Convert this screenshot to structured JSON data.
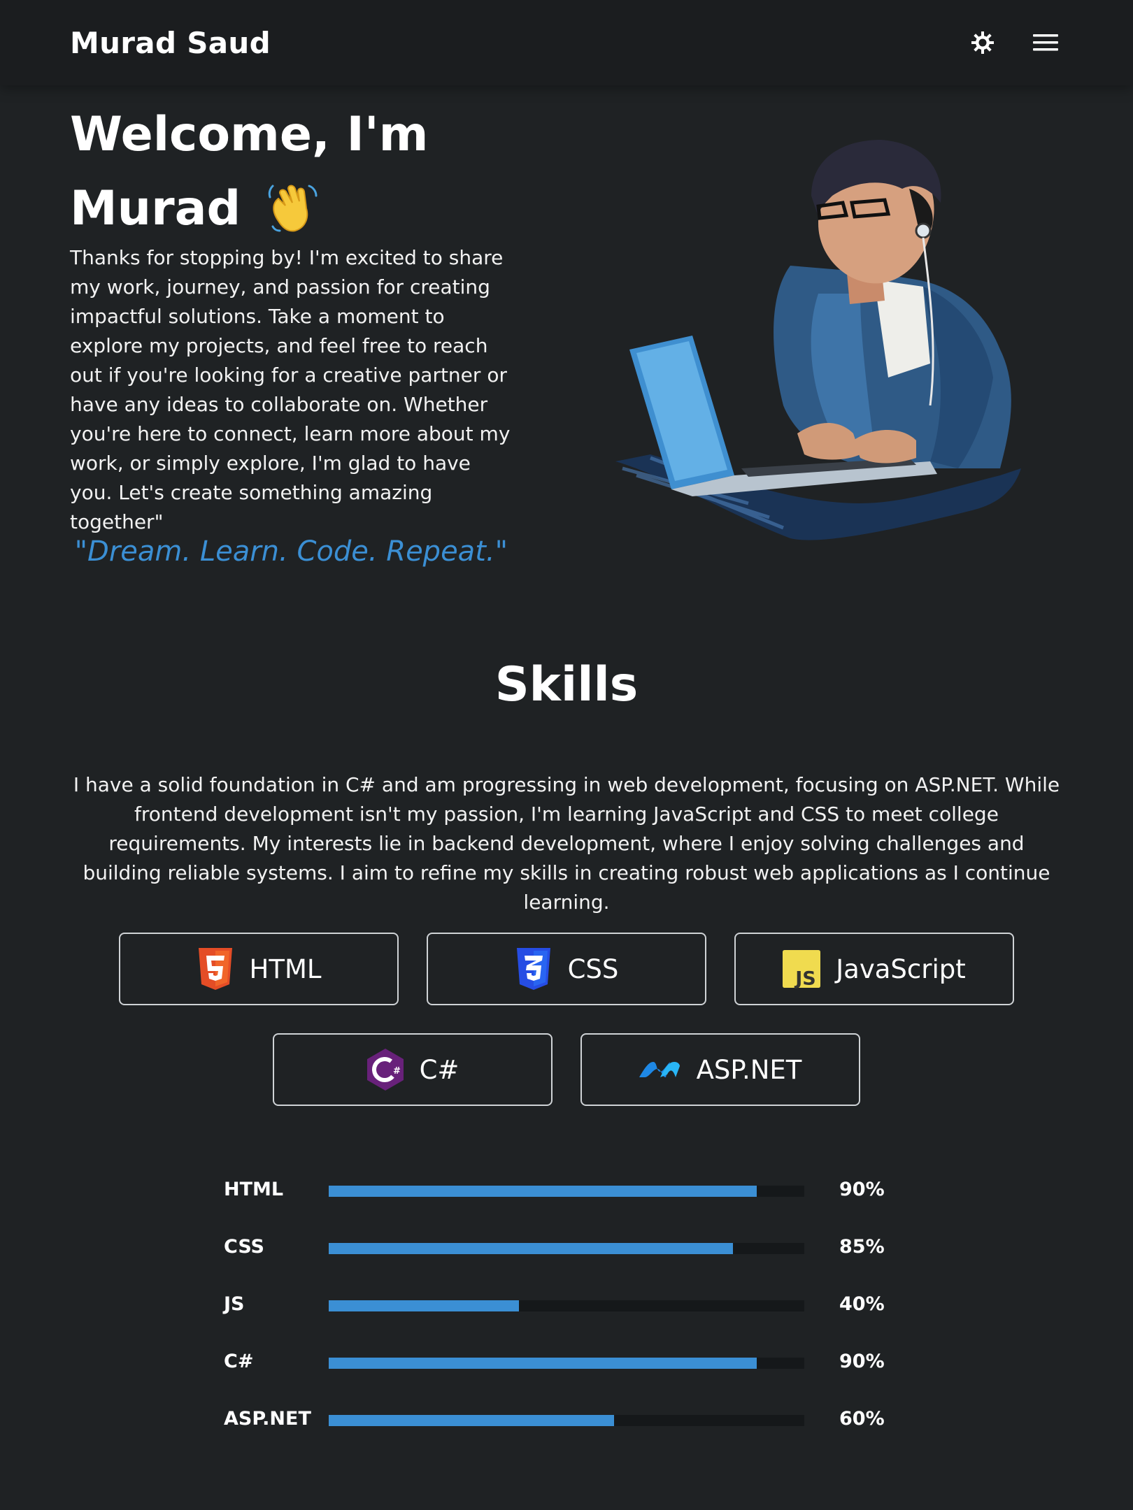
{
  "header": {
    "brand": "Murad Saud",
    "theme_toggle_icon": "sun-icon",
    "menu_icon": "hamburger-menu-icon"
  },
  "hero": {
    "title_line1": "Welcome, I'm",
    "title_line2": "Murad",
    "title_icon": "waving-hand-icon",
    "intro": "Thanks for stopping by! I'm excited to share my work, journey, and passion for creating impactful solutions. Take a moment to explore my projects, and feel free to reach out if you're looking for a creative partner or have any ideas to collaborate on. Whether you're here to connect, learn more about my work, or simply explore, I'm glad to have you. Let's create something amazing together\"",
    "quote": "\"Dream. Learn. Code. Repeat.\"",
    "illustration": "developer-with-laptop-illustration"
  },
  "skills": {
    "title": "Skills",
    "description": "I have a solid foundation in C# and am progressing in web development, focusing on ASP.NET. While frontend development isn't my passion, I'm learning JavaScript and CSS to meet college requirements. My interests lie in backend development, where I enjoy solving challenges and building reliable systems. I aim to refine my skills in creating robust web applications as I continue learning.",
    "cards": [
      {
        "label": "HTML",
        "icon": "html5-icon"
      },
      {
        "label": "CSS",
        "icon": "css3-icon"
      },
      {
        "label": "JavaScript",
        "icon": "javascript-icon"
      },
      {
        "label": "C#",
        "icon": "csharp-icon"
      },
      {
        "label": "ASP.NET",
        "icon": "aspnet-icon"
      }
    ],
    "bars": [
      {
        "label": "HTML",
        "percent": 90,
        "text": "90%"
      },
      {
        "label": "CSS",
        "percent": 85,
        "text": "85%"
      },
      {
        "label": "JS",
        "percent": 40,
        "text": "40%"
      },
      {
        "label": "C#",
        "percent": 90,
        "text": "90%"
      },
      {
        "label": "ASP.NET",
        "percent": 60,
        "text": "60%"
      }
    ]
  },
  "colors": {
    "background": "#1f2224",
    "navbar": "#1b1d1f",
    "accent": "#3b8fd4",
    "html": "#e44d26",
    "css": "#264de4",
    "javascript": "#f0db4f",
    "csharp": "#68217a",
    "aspnet": "#1e88e5"
  }
}
